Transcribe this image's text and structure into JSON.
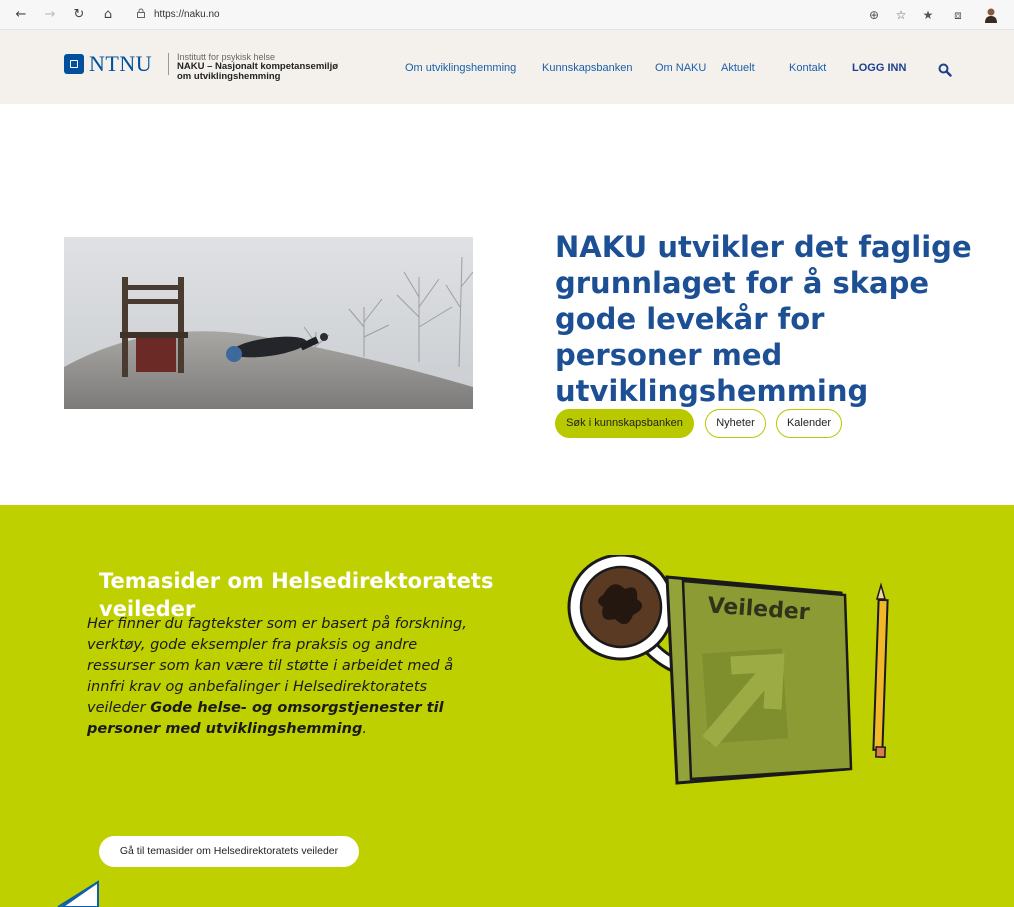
{
  "browser": {
    "url": "https://naku.no",
    "icons": [
      "back-icon",
      "forward-icon",
      "reload-icon",
      "home-icon",
      "lock-icon",
      "zoom-icon",
      "favorite-icon",
      "favorites-list-icon",
      "collections-icon",
      "profile-icon"
    ]
  },
  "header": {
    "logo_text": "NTNU",
    "institute": "Institutt for psykisk helse",
    "unit_line1": "NAKU – Nasjonalt kompetansemiljø",
    "unit_line2": "om utviklingshemming",
    "nav": [
      "Om utviklingshemming",
      "Kunnskapsbanken",
      "Om NAKU",
      "Aktuelt",
      "Kontakt",
      "LOGG INN"
    ]
  },
  "hero": {
    "title": "NAKU utvikler det faglige grunnlaget for å skape gode levekår for personer med utviklingshemming",
    "buttons": [
      "Søk i kunnskapsbanken",
      "Nyheter",
      "Kalender"
    ]
  },
  "guide": {
    "title": "Temasider om Helsedirektoratets veileder",
    "body_pre": "Her finner du fagtekster som er basert på forskning, verktøy, gode eksempler fra praksis og andre ressurser som kan være til støtte i arbeidet med å innfri krav og anbefalinger i Helsedirektoratets veileder ",
    "body_bold": "Gode helse- og omsorgstjenester til personer med utviklingshemming",
    "body_post": ".",
    "book_label": "Veileder",
    "button": "Gå til temasider om Helsedirektoratets veileder"
  },
  "colors": {
    "accent_green": "#bfd000",
    "brand_blue": "#1c4f93",
    "header_bg": "#f4f1ec"
  }
}
